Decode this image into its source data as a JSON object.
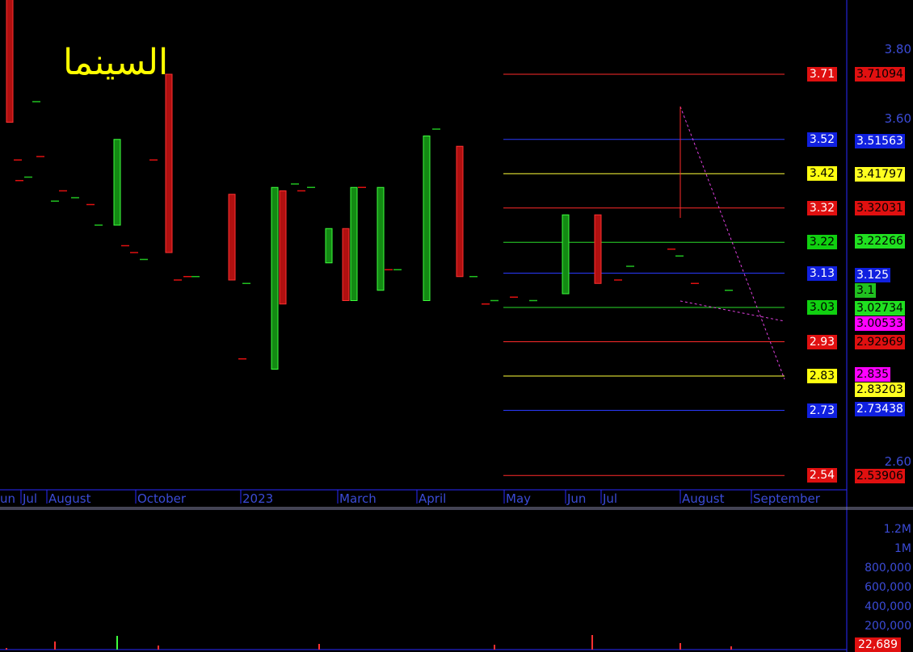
{
  "chart_data": {
    "type": "candlestick",
    "title": "السينما",
    "y_axis": {
      "ticks": [
        "3.80",
        "3.60",
        "2.60"
      ]
    },
    "volume_axis": {
      "ticks": [
        "1.2M",
        "1M",
        "800,000",
        "600,000",
        "400,000",
        "200,000"
      ]
    },
    "volume_last": "22,689",
    "x_labels": [
      "un",
      "Jul",
      "August",
      "October",
      "2023",
      "March",
      "April",
      "May",
      "Jun",
      "Jul",
      "August",
      "September"
    ],
    "levels": [
      {
        "value": 3.71,
        "label": "3.71",
        "color": "#ff2a2a"
      },
      {
        "value": 3.52,
        "label": "3.52",
        "color": "#2a3aff"
      },
      {
        "value": 3.42,
        "label": "3.42",
        "color": "#ffff3a"
      },
      {
        "value": 3.32,
        "label": "3.32",
        "color": "#ff2a2a"
      },
      {
        "value": 3.22,
        "label": "3.22",
        "color": "#2adc2a"
      },
      {
        "value": 3.13,
        "label": "3.13",
        "color": "#2a3aff"
      },
      {
        "value": 3.03,
        "label": "3.03",
        "color": "#2adc2a"
      },
      {
        "value": 2.93,
        "label": "2.93",
        "color": "#ff2a2a"
      },
      {
        "value": 2.83,
        "label": "2.83",
        "color": "#ffff3a"
      },
      {
        "value": 2.73,
        "label": "2.73",
        "color": "#2a3aff"
      },
      {
        "value": 2.54,
        "label": "2.54",
        "color": "#ff2a2a"
      }
    ],
    "axis_values": [
      {
        "value": 3.71094,
        "label": "3.71094",
        "bg": "#e01010",
        "fg": "#000000"
      },
      {
        "value": 3.51563,
        "label": "3.51563",
        "bg": "#1020e0",
        "fg": "#ffffff"
      },
      {
        "value": 3.41797,
        "label": "3.41797",
        "bg": "#ffff20",
        "fg": "#000000"
      },
      {
        "value": 3.32031,
        "label": "3.32031",
        "bg": "#e01010",
        "fg": "#000000"
      },
      {
        "value": 3.22266,
        "label": "3.22266",
        "bg": "#20e020",
        "fg": "#000000"
      },
      {
        "value": 3.125,
        "label": "3.125",
        "bg": "#1020e0",
        "fg": "#ffffff"
      },
      {
        "value": 3.1,
        "label": "3.1",
        "bg": "#20c020",
        "fg": "#000000"
      },
      {
        "value": 3.02734,
        "label": "3.02734",
        "bg": "#20e020",
        "fg": "#000000"
      },
      {
        "value": 3.00533,
        "label": "3.00533",
        "bg": "#ff00ff",
        "fg": "#000000"
      },
      {
        "value": 2.92969,
        "label": "2.92969",
        "bg": "#e01010",
        "fg": "#000000"
      },
      {
        "value": 2.835,
        "label": "2.835",
        "bg": "#ff00ff",
        "fg": "#000000"
      },
      {
        "value": 2.83203,
        "label": "2.83203",
        "bg": "#ffff20",
        "fg": "#000000"
      },
      {
        "value": 2.73438,
        "label": "2.73438",
        "bg": "#1020e0",
        "fg": "#ffffff"
      },
      {
        "value": 2.53906,
        "label": "2.53906",
        "bg": "#e01010",
        "fg": "#000000"
      }
    ],
    "candles": [
      {
        "i": 1,
        "o": 3.97,
        "c": 3.57,
        "dir": "down"
      },
      {
        "i": 2,
        "o": 3.46,
        "c": 3.46,
        "dir": "flat"
      },
      {
        "i": 3,
        "o": 3.63,
        "c": 3.63,
        "dir": "flat"
      },
      {
        "i": 4,
        "o": 3.4,
        "c": 3.4,
        "dir": "flat"
      },
      {
        "i": 5,
        "o": 3.41,
        "c": 3.41,
        "dir": "flat"
      },
      {
        "i": 6,
        "o": 3.47,
        "c": 3.47,
        "dir": "flat"
      },
      {
        "i": 7,
        "o": 3.34,
        "c": 3.34,
        "dir": "flat"
      },
      {
        "i": 8,
        "o": 3.37,
        "c": 3.37,
        "dir": "flat"
      },
      {
        "i": 9,
        "o": 3.35,
        "c": 3.35,
        "dir": "flat"
      },
      {
        "i": 10,
        "o": 3.33,
        "c": 3.33,
        "dir": "flat"
      },
      {
        "i": 11,
        "o": 3.27,
        "c": 3.27,
        "dir": "flat"
      },
      {
        "i": 12,
        "o": 3.21,
        "c": 3.21,
        "dir": "flat"
      },
      {
        "i": 13,
        "o": 3.27,
        "c": 3.52,
        "dir": "up"
      },
      {
        "i": 14,
        "o": 3.19,
        "c": 3.19,
        "dir": "flat"
      },
      {
        "i": 15,
        "o": 3.17,
        "c": 3.17,
        "dir": "flat"
      },
      {
        "i": 16,
        "o": 3.46,
        "c": 3.46,
        "dir": "flat"
      },
      {
        "i": 17,
        "o": 3.71,
        "c": 3.19,
        "dir": "down"
      },
      {
        "i": 18,
        "o": 3.11,
        "c": 3.11,
        "dir": "flat"
      },
      {
        "i": 19,
        "o": 3.38,
        "c": 3.38,
        "dir": "flat"
      },
      {
        "i": 20,
        "o": 3.12,
        "c": 3.12,
        "dir": "flat"
      },
      {
        "i": 21,
        "o": 3.12,
        "c": 3.12,
        "dir": "flat"
      },
      {
        "i": 22,
        "o": 3.36,
        "c": 3.11,
        "dir": "down"
      },
      {
        "i": 23,
        "o": 3.1,
        "c": 3.1,
        "dir": "flat"
      },
      {
        "i": 24,
        "o": 2.88,
        "c": 2.88,
        "dir": "flat"
      },
      {
        "i": 25,
        "o": 2.85,
        "c": 3.38,
        "dir": "up"
      },
      {
        "i": 26,
        "o": 3.37,
        "c": 3.04,
        "dir": "down"
      },
      {
        "i": 27,
        "o": 3.39,
        "c": 3.39,
        "dir": "flat"
      },
      {
        "i": 28,
        "o": 3.37,
        "c": 3.37,
        "dir": "flat"
      },
      {
        "i": 29,
        "o": 3.26,
        "c": 3.16,
        "dir": "up"
      },
      {
        "i": 30,
        "o": 3.26,
        "c": 3.05,
        "dir": "down"
      },
      {
        "i": 31,
        "o": 3.05,
        "c": 3.38,
        "dir": "up"
      },
      {
        "i": 32,
        "o": 3.38,
        "c": 3.08,
        "dir": "flat"
      },
      {
        "i": 33,
        "o": 3.08,
        "c": 3.38,
        "dir": "up"
      },
      {
        "i": 34,
        "o": 3.14,
        "c": 3.14,
        "dir": "flat"
      },
      {
        "i": 35,
        "o": 3.14,
        "c": 3.14,
        "dir": "flat"
      },
      {
        "i": 36,
        "o": 3.05,
        "c": 3.53,
        "dir": "up"
      },
      {
        "i": 37,
        "o": 3.55,
        "c": 3.55,
        "dir": "flat"
      },
      {
        "i": 38,
        "o": 3.5,
        "c": 3.12,
        "dir": "down"
      },
      {
        "i": 39,
        "o": 3.12,
        "c": 3.12,
        "dir": "flat"
      },
      {
        "i": 40,
        "o": 3.04,
        "c": 3.04,
        "dir": "flat"
      },
      {
        "i": 41,
        "o": 3.05,
        "c": 3.05,
        "dir": "flat"
      },
      {
        "i": 42,
        "o": 3.06,
        "c": 3.06,
        "dir": "flat"
      },
      {
        "i": 43,
        "o": 3.05,
        "c": 3.05,
        "dir": "flat"
      },
      {
        "i": 44,
        "o": 3.07,
        "c": 3.3,
        "dir": "up"
      },
      {
        "i": 45,
        "o": 3.3,
        "c": 3.1,
        "dir": "down"
      },
      {
        "i": 46,
        "o": 3.11,
        "c": 3.11,
        "dir": "flat"
      },
      {
        "i": 47,
        "o": 3.15,
        "c": 3.15,
        "dir": "flat"
      },
      {
        "i": 48,
        "o": 3.2,
        "c": 3.2,
        "dir": "flat"
      },
      {
        "i": 49,
        "o": 3.18,
        "c": 3.18,
        "dir": "flat"
      },
      {
        "i": 50,
        "o": 3.1,
        "c": 3.1,
        "dir": "flat"
      },
      {
        "i": 51,
        "o": 3.08,
        "c": 3.08,
        "dir": "flat"
      }
    ]
  }
}
